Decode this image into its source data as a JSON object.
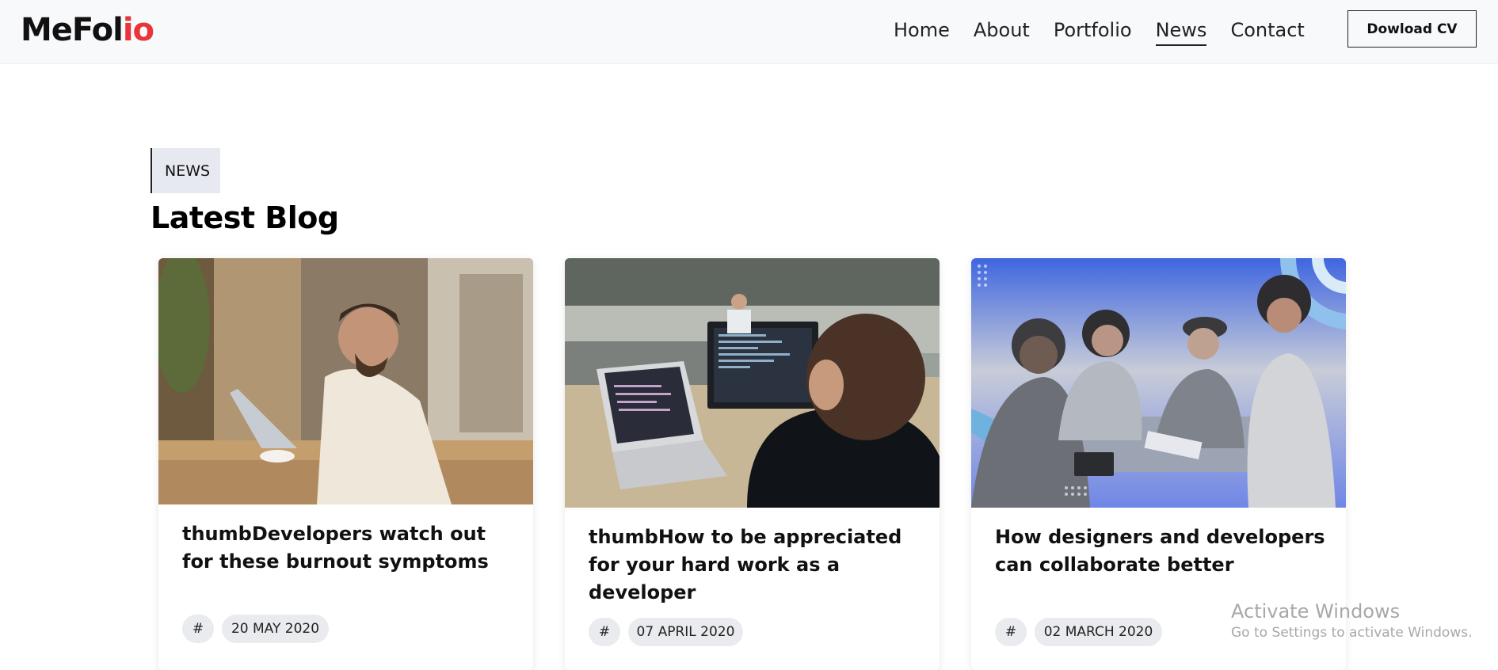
{
  "brand": {
    "name_main": "MeFol",
    "name_accent": "io"
  },
  "nav": {
    "items": [
      {
        "label": "Home"
      },
      {
        "label": "About"
      },
      {
        "label": "Portfolio"
      },
      {
        "label": "News",
        "active": true
      },
      {
        "label": "Contact"
      }
    ],
    "cv_button": "Dowload CV"
  },
  "section": {
    "tag": "NEWS",
    "title": "Latest Blog"
  },
  "posts": [
    {
      "title": "thumbDevelopers watch out for these burnout symptoms",
      "tag": "#",
      "date": "20 MAY 2020"
    },
    {
      "title": "thumbHow to be appreciated for your hard work as a developer",
      "tag": "#",
      "date": "07 APRIL 2020"
    },
    {
      "title": "How designers and developers can collaborate better",
      "tag": "#",
      "date": "02 MARCH 2020"
    }
  ],
  "watermark": {
    "line1": "Activate Windows",
    "line2": "Go to Settings to activate Windows."
  },
  "colors": {
    "accent": "#e8343a",
    "navbar_bg": "#f8f9fa",
    "tag_bg": "#e6eaf0",
    "pill_bg": "#e9ebee"
  }
}
